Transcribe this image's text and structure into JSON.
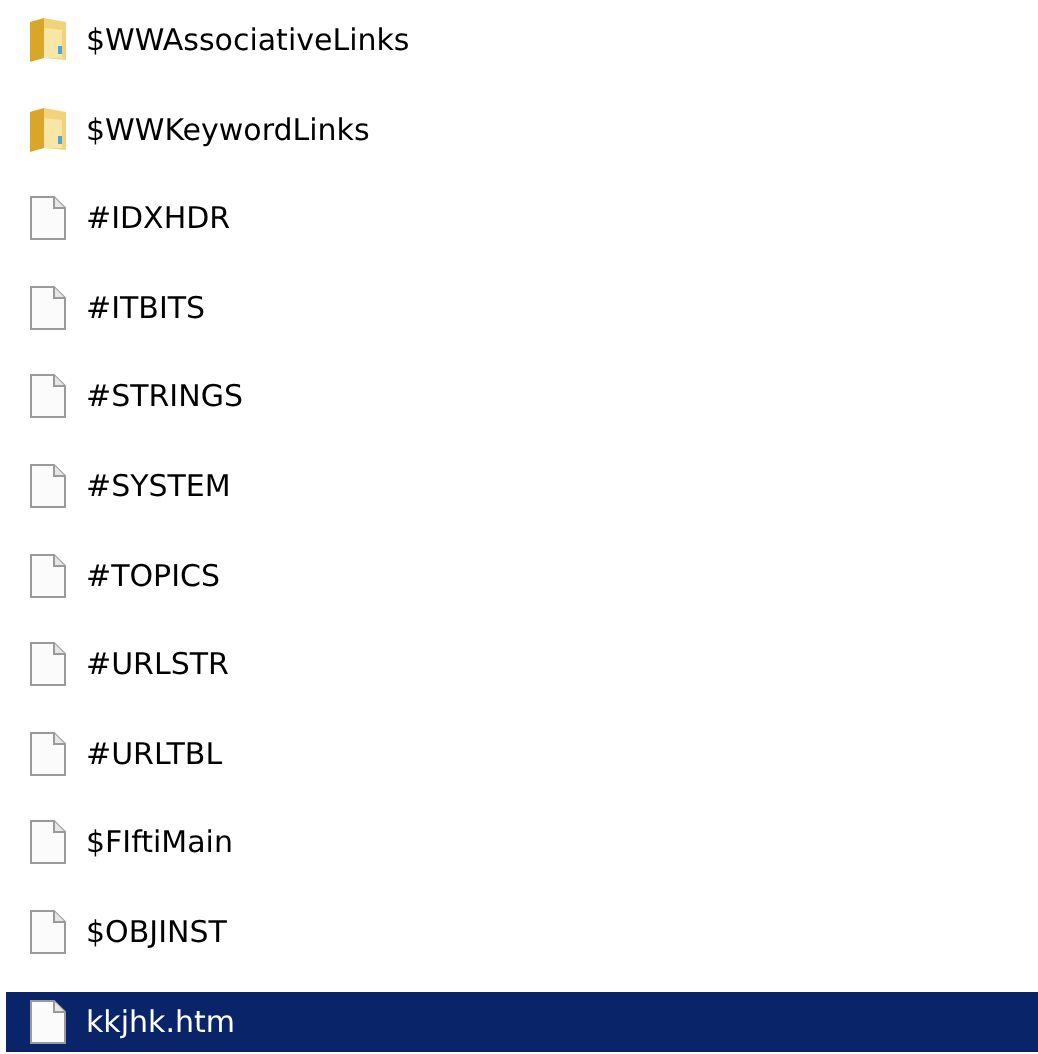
{
  "files": [
    {
      "name": "$WWAssociativeLinks",
      "kind": "folder",
      "selected": false
    },
    {
      "name": "$WWKeywordLinks",
      "kind": "folder",
      "selected": false
    },
    {
      "name": "#IDXHDR",
      "kind": "file",
      "selected": false
    },
    {
      "name": "#ITBITS",
      "kind": "file",
      "selected": false
    },
    {
      "name": "#STRINGS",
      "kind": "file",
      "selected": false
    },
    {
      "name": "#SYSTEM",
      "kind": "file",
      "selected": false
    },
    {
      "name": "#TOPICS",
      "kind": "file",
      "selected": false
    },
    {
      "name": "#URLSTR",
      "kind": "file",
      "selected": false
    },
    {
      "name": "#URLTBL",
      "kind": "file",
      "selected": false
    },
    {
      "name": "$FIftiMain",
      "kind": "file",
      "selected": false
    },
    {
      "name": "$OBJINST",
      "kind": "file",
      "selected": false
    },
    {
      "name": "kkjhk.htm",
      "kind": "file",
      "selected": true
    }
  ]
}
